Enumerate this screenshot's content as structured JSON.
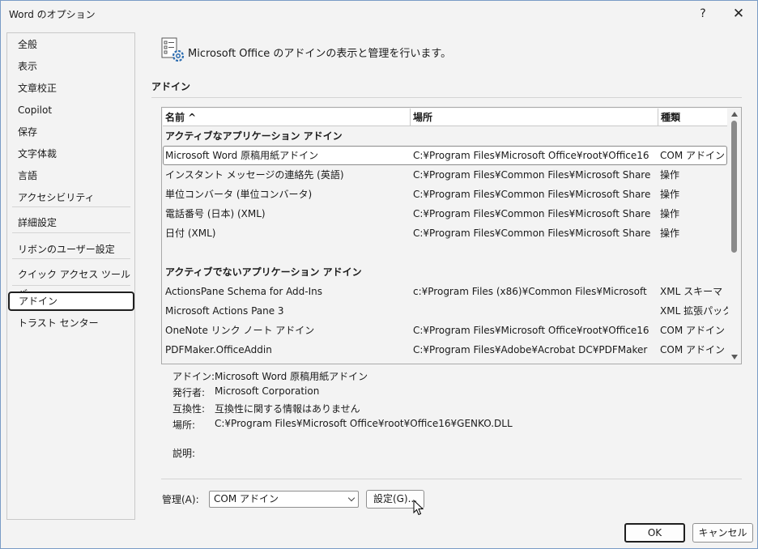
{
  "window": {
    "title": "Word のオプション",
    "help_label": "?",
    "close_label": "✕"
  },
  "sidebar": {
    "items": [
      {
        "label": "全般"
      },
      {
        "label": "表示"
      },
      {
        "label": "文章校正"
      },
      {
        "label": "Copilot"
      },
      {
        "label": "保存"
      },
      {
        "label": "文字体裁"
      },
      {
        "label": "言語"
      },
      {
        "label": "アクセシビリティ"
      },
      {
        "label": "詳細設定"
      },
      {
        "label": "リボンのユーザー設定"
      },
      {
        "label": "クイック アクセス ツール バー"
      },
      {
        "label": "アドイン",
        "selected": true
      },
      {
        "label": "トラスト センター"
      }
    ]
  },
  "header": {
    "text": "Microsoft Office のアドインの表示と管理を行います。",
    "icon": "addin-settings-icon"
  },
  "section": {
    "title": "アドイン"
  },
  "table": {
    "columns": [
      "名前 ^",
      "場所",
      "種類"
    ],
    "rows": [
      {
        "group": "アクティブなアプリケーション アドイン"
      },
      {
        "name": "Microsoft Word 原稿用紙アドイン",
        "location": "C:¥Program Files¥Microsoft Office¥root¥Office16",
        "type": "COM アドイン",
        "selected": true
      },
      {
        "name": "インスタント メッセージの連絡先 (英語)",
        "location": "C:¥Program Files¥Common Files¥Microsoft Share",
        "type": "操作"
      },
      {
        "name": "単位コンバータ (単位コンバータ)",
        "location": "C:¥Program Files¥Common Files¥Microsoft Share",
        "type": "操作"
      },
      {
        "name": "電話番号 (日本) (XML)",
        "location": "C:¥Program Files¥Common Files¥Microsoft Share",
        "type": "操作"
      },
      {
        "name": "日付 (XML)",
        "location": "C:¥Program Files¥Common Files¥Microsoft Share",
        "type": "操作"
      },
      {
        "spacer": true
      },
      {
        "group": "アクティブでないアプリケーション アドイン"
      },
      {
        "name": "ActionsPane Schema for Add-Ins",
        "location": "c:¥Program Files (x86)¥Common Files¥Microsoft",
        "type": "XML スキーマ"
      },
      {
        "name": "Microsoft Actions Pane 3",
        "location": "",
        "type": "XML 拡張パック"
      },
      {
        "name": "OneNote リンク ノート アドイン",
        "location": "C:¥Program Files¥Microsoft Office¥root¥Office16",
        "type": "COM アドイン"
      },
      {
        "name": "PDFMaker.OfficeAddin",
        "location": "C:¥Program Files¥Adobe¥Acrobat DC¥PDFMaker",
        "type": "COM アドイン"
      }
    ]
  },
  "details": {
    "addin_label": "アドイン:",
    "addin_value": "Microsoft Word 原稿用紙アドイン",
    "publisher_label": "発行者:",
    "publisher_value": "Microsoft Corporation",
    "compat_label": "互換性:",
    "compat_value": "互換性に関する情報はありません",
    "location_label": "場所:",
    "location_value": "C:¥Program Files¥Microsoft Office¥root¥Office16¥GENKO.DLL",
    "description_label": "説明:"
  },
  "manage": {
    "label": "管理(A):",
    "selected": "COM アドイン",
    "settings_button": "設定(G)..."
  },
  "footer": {
    "ok": "OK",
    "cancel": "キャンセル"
  }
}
